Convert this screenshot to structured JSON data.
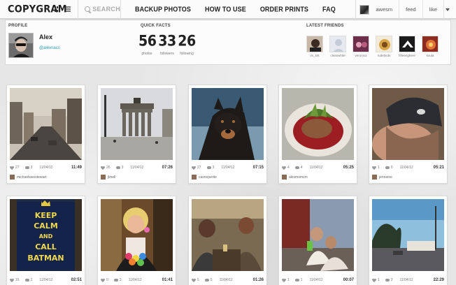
{
  "app": {
    "logo": "COPYGRAM",
    "search_placeholder": "SEARCH",
    "nav": [
      "BACKUP PHOTOS",
      "HOW TO USE",
      "ORDER PRINTS",
      "FAQ"
    ],
    "user": {
      "name": "awesm",
      "links": [
        "feed",
        "like"
      ]
    }
  },
  "profile": {
    "section_label": "PROFILE",
    "name": "Alex",
    "sub": "@alexnacs",
    "stats_label": "QUICK FACTS",
    "stats": [
      {
        "value": "56",
        "label": "photos"
      },
      {
        "value": "33",
        "label": "followers"
      },
      {
        "value": "26",
        "label": "following"
      }
    ],
    "friends_label": "LATEST FRIENDS",
    "friends": [
      "im_kitt",
      "cleanwhite",
      "veronica",
      "rudebirds",
      "fifteenghere",
      "koula"
    ]
  },
  "photos": [
    {
      "likes": "27",
      "comments": "3",
      "date": "11/04/12",
      "time": "11:49",
      "owner": "michaelwesstewart"
    },
    {
      "likes": "26",
      "comments": "3",
      "date": "11/04/12",
      "time": "07:26",
      "owner": "jlmell"
    },
    {
      "likes": "27",
      "comments": "3",
      "date": "11/04/12",
      "time": "07:15",
      "owner": "casnoperite"
    },
    {
      "likes": "4",
      "comments": "4",
      "date": "11/04/12",
      "time": "05:25",
      "owner": "alexmxmcm"
    },
    {
      "likes": "1",
      "comments": "0",
      "date": "11/04/12",
      "time": "05:21",
      "owner": "jenneine"
    },
    {
      "likes": "15",
      "comments": "2",
      "date": "11/04/12",
      "time": "02:51",
      "owner": ""
    },
    {
      "likes": "0",
      "comments": "3",
      "date": "11/04/12",
      "time": "01:41",
      "owner": ""
    },
    {
      "likes": "5",
      "comments": "5",
      "date": "11/04/12",
      "time": "01:26",
      "owner": ""
    },
    {
      "likes": "1",
      "comments": "1",
      "date": "11/04/12",
      "time": "00:07",
      "owner": ""
    },
    {
      "likes": "1",
      "comments": "2",
      "date": "11/04/12",
      "time": "22:29",
      "owner": ""
    }
  ],
  "poster_text": [
    "KEEP",
    "CALM",
    "AND",
    "CALL",
    "BATMAN"
  ],
  "colors": {
    "accent": "#2a9fb6",
    "background": "#e9e9e9",
    "card": "#ffffff"
  }
}
